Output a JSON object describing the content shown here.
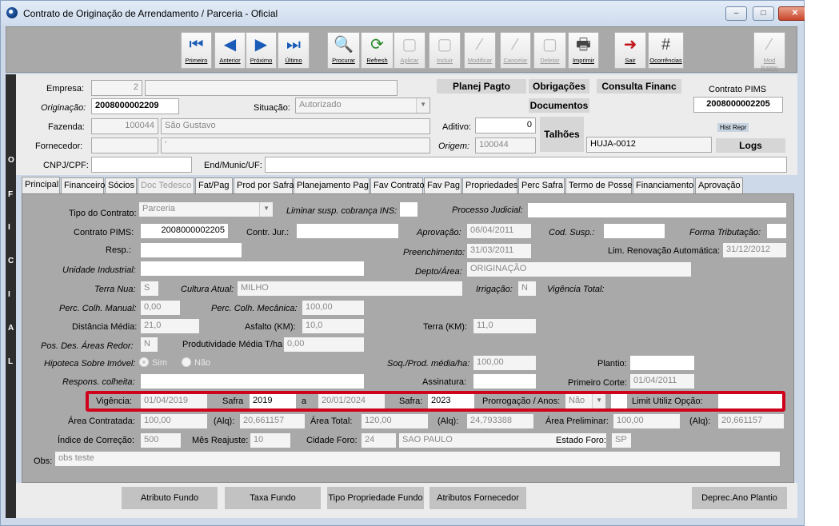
{
  "window": {
    "title": "Contrato de Originação de Arrendamento / Parceria - Oficial",
    "min": "–",
    "max": "□",
    "close": "✕"
  },
  "toolbar": [
    {
      "label": "Primeiro",
      "icon": "first-icon",
      "glyph": "⏮",
      "enabled": true
    },
    {
      "label": "Anterior",
      "icon": "prev-icon",
      "glyph": "◀",
      "enabled": true
    },
    {
      "label": "Próximo",
      "icon": "next-icon",
      "glyph": "▶",
      "enabled": true
    },
    {
      "label": "Último",
      "icon": "last-icon",
      "glyph": "⏭",
      "enabled": true
    },
    {
      "label": "Procurar",
      "icon": "search-icon",
      "glyph": "🔍",
      "enabled": true
    },
    {
      "label": "Refresh",
      "icon": "refresh-icon",
      "glyph": "⟳",
      "enabled": true
    },
    {
      "label": "Aplicar",
      "icon": "apply-icon",
      "glyph": "▢",
      "enabled": false
    },
    {
      "label": "Incluir",
      "icon": "add-icon",
      "glyph": "▢",
      "enabled": false
    },
    {
      "label": "Modificar",
      "icon": "edit-icon",
      "glyph": "⁄",
      "enabled": false
    },
    {
      "label": "Cancelar",
      "icon": "cancel-icon",
      "glyph": "⁄",
      "enabled": false
    },
    {
      "label": "Deletar",
      "icon": "delete-icon",
      "glyph": "▢",
      "enabled": false
    },
    {
      "label": "Imprimir",
      "icon": "print-icon",
      "glyph": "🖶",
      "enabled": true
    },
    {
      "label": "Sair",
      "icon": "exit-icon",
      "glyph": "➜",
      "enabled": true
    },
    {
      "label": "Ocorrências",
      "icon": "grid-icon",
      "glyph": "#",
      "enabled": true
    },
    {
      "label": "Mod Rateio",
      "icon": "rateio-icon",
      "glyph": "⁄",
      "enabled": false
    }
  ],
  "side_letters": [
    "O",
    "F",
    "I",
    "C",
    "I",
    "A",
    "L"
  ],
  "header": {
    "empresa_label": "Empresa:",
    "empresa": "2",
    "originacao_label": "Originação:",
    "originacao": "2008000002209",
    "situacao_label": "Situação:",
    "situacao": "Autorizado",
    "fazenda_label": "Fazenda:",
    "fazenda_code": "100044",
    "fazenda_name": "São Gustavo",
    "fornecedor_label": "Fornecedor:",
    "fornecedor_mark": "'",
    "cnpj_label": "CNPJ/CPF:",
    "endmunic_label": "End/Munic/UF:",
    "planej_pagto": "Planej Pagto",
    "obrigacoes": "Obrigações",
    "consulta_financ": "Consulta Financ",
    "documentos": "Documentos",
    "contrato_pims_label": "Contrato PIMS",
    "contrato_pims": "2008000002205",
    "aditivo_label": "Aditivo:",
    "aditivo": "0",
    "origem_label": "Origem:",
    "origem": "100044",
    "talhoes": "Talhões",
    "talhao_code": "HUJA-0012",
    "hist_repr": "Hist Repr",
    "logs": "Logs"
  },
  "tabs": [
    {
      "label": "Principal",
      "active": true,
      "enabled": true
    },
    {
      "label": "Financeiro",
      "enabled": true
    },
    {
      "label": "Sócios",
      "enabled": true
    },
    {
      "label": "Doc Tedesco",
      "enabled": false
    },
    {
      "label": "Fat/Pag",
      "enabled": true
    },
    {
      "label": "Prod por Safra",
      "enabled": true
    },
    {
      "label": "Planejamento Pag",
      "enabled": true
    },
    {
      "label": "Fav Contrato",
      "enabled": true
    },
    {
      "label": "Fav Pag",
      "enabled": true
    },
    {
      "label": "Propriedades",
      "enabled": true
    },
    {
      "label": "Perc Safra",
      "enabled": true
    },
    {
      "label": "Termo de Posse",
      "enabled": true
    },
    {
      "label": "Financiamento",
      "enabled": true
    },
    {
      "label": "Aprovação",
      "enabled": true
    }
  ],
  "principal": {
    "tipo_contrato_label": "Tipo do Contrato:",
    "tipo_contrato": "Parceria",
    "liminar_label": "Liminar susp. cobrança INS:",
    "processo_label": "Processo Judicial:",
    "contrato_pims_label": "Contrato PIMS:",
    "contrato_pims": "2008000002205",
    "contr_jur_label": "Contr. Jur.:",
    "aprovacao_label": "Aprovação:",
    "aprovacao": "06/04/2011",
    "cod_susp_label": "Cod. Susp.:",
    "forma_trib_label": "Forma Tributação:",
    "resp_label": "Resp.:",
    "preenchimento_label": "Preenchimento:",
    "preenchimento": "31/03/2011",
    "lim_renov_label": "Lim. Renovação Automática:",
    "lim_renov": "31/12/2012",
    "unidade_label": "Unidade Industrial:",
    "depto_label": "Depto/Área:",
    "depto": "ORIGINAÇÃO",
    "terra_nua_label": "Terra Nua:",
    "terra_nua": "S",
    "cultura_label": "Cultura Atual:",
    "cultura": "MILHO",
    "irrigacao_label": "Irrigação:",
    "irrigacao": "N",
    "vigencia_total_label": "Vigência Total:",
    "perc_manual_label": "Perc. Colh. Manual:",
    "perc_manual": "0,00",
    "perc_mec_label": "Perc. Colh. Mecânica:",
    "perc_mec": "100,00",
    "distancia_label": "Distância Média:",
    "distancia": "21,0",
    "asfalto_label": "Asfalto (KM):",
    "asfalto": "10,0",
    "terra_km_label": "Terra (KM):",
    "terra_km": "11,0",
    "pos_des_label": "Pos. Des. Áreas Redor:",
    "pos_des": "N",
    "produtividade_label": "Produtividade Média T/ha:",
    "produtividade": "0,00",
    "hipoteca_label": "Hipoteca Sobre Imóvel:",
    "sim": "Sim",
    "nao": "Não",
    "soq_label": "Soq./Prod. média/ha:",
    "soq": "100,00",
    "plantio_label": "Plantio:",
    "respons_label": "Respons. colheita:",
    "assinatura_label": "Assinatura:",
    "primeiro_corte_label": "Primeiro Corte:",
    "primeiro_corte": "01/04/2011",
    "vigencia_label": "Vigência:",
    "vigencia_ini": "01/04/2019",
    "safra_label": "Safra",
    "safra_ini": "2019",
    "a_label": "a",
    "vigencia_fim": "20/01/2024",
    "safra2_label": "Safra:",
    "safra_fim": "2023",
    "prorrogacao_label": "Prorrogação / Anos:",
    "prorrogacao": "Não",
    "limit_label": "Limit Utiliz Opção:",
    "area_contratada_label": "Área Contratada:",
    "area_contratada": "100,00",
    "alq_label": "(Alq):",
    "alq1": "20,661157",
    "area_total_label": "Área Total:",
    "area_total": "120,00",
    "alq2": "24,793388",
    "area_prelim_label": "Área Preliminar:",
    "area_prelim": "100,00",
    "alq3": "20,661157",
    "indice_label": "Índice de Correção:",
    "indice": "500",
    "mes_reajuste_label": "Mês Reajuste:",
    "mes_reajuste": "10",
    "cidade_foro_label": "Cidade Foro:",
    "cidade_code": "24",
    "cidade": "SAO PAULO",
    "estado_foro_label": "Estado Foro:",
    "estado": "SP",
    "obs_label": "Obs:",
    "obs": "obs teste"
  },
  "bottom_buttons": {
    "atributo_fundo": "Atributo Fundo",
    "taxa_fundo": "Taxa Fundo",
    "tipo_prop": "Tipo Propriedade Fundo",
    "atrib_fornec": "Atributos Fornecedor",
    "deprec": "Deprec.Ano Plantio"
  }
}
